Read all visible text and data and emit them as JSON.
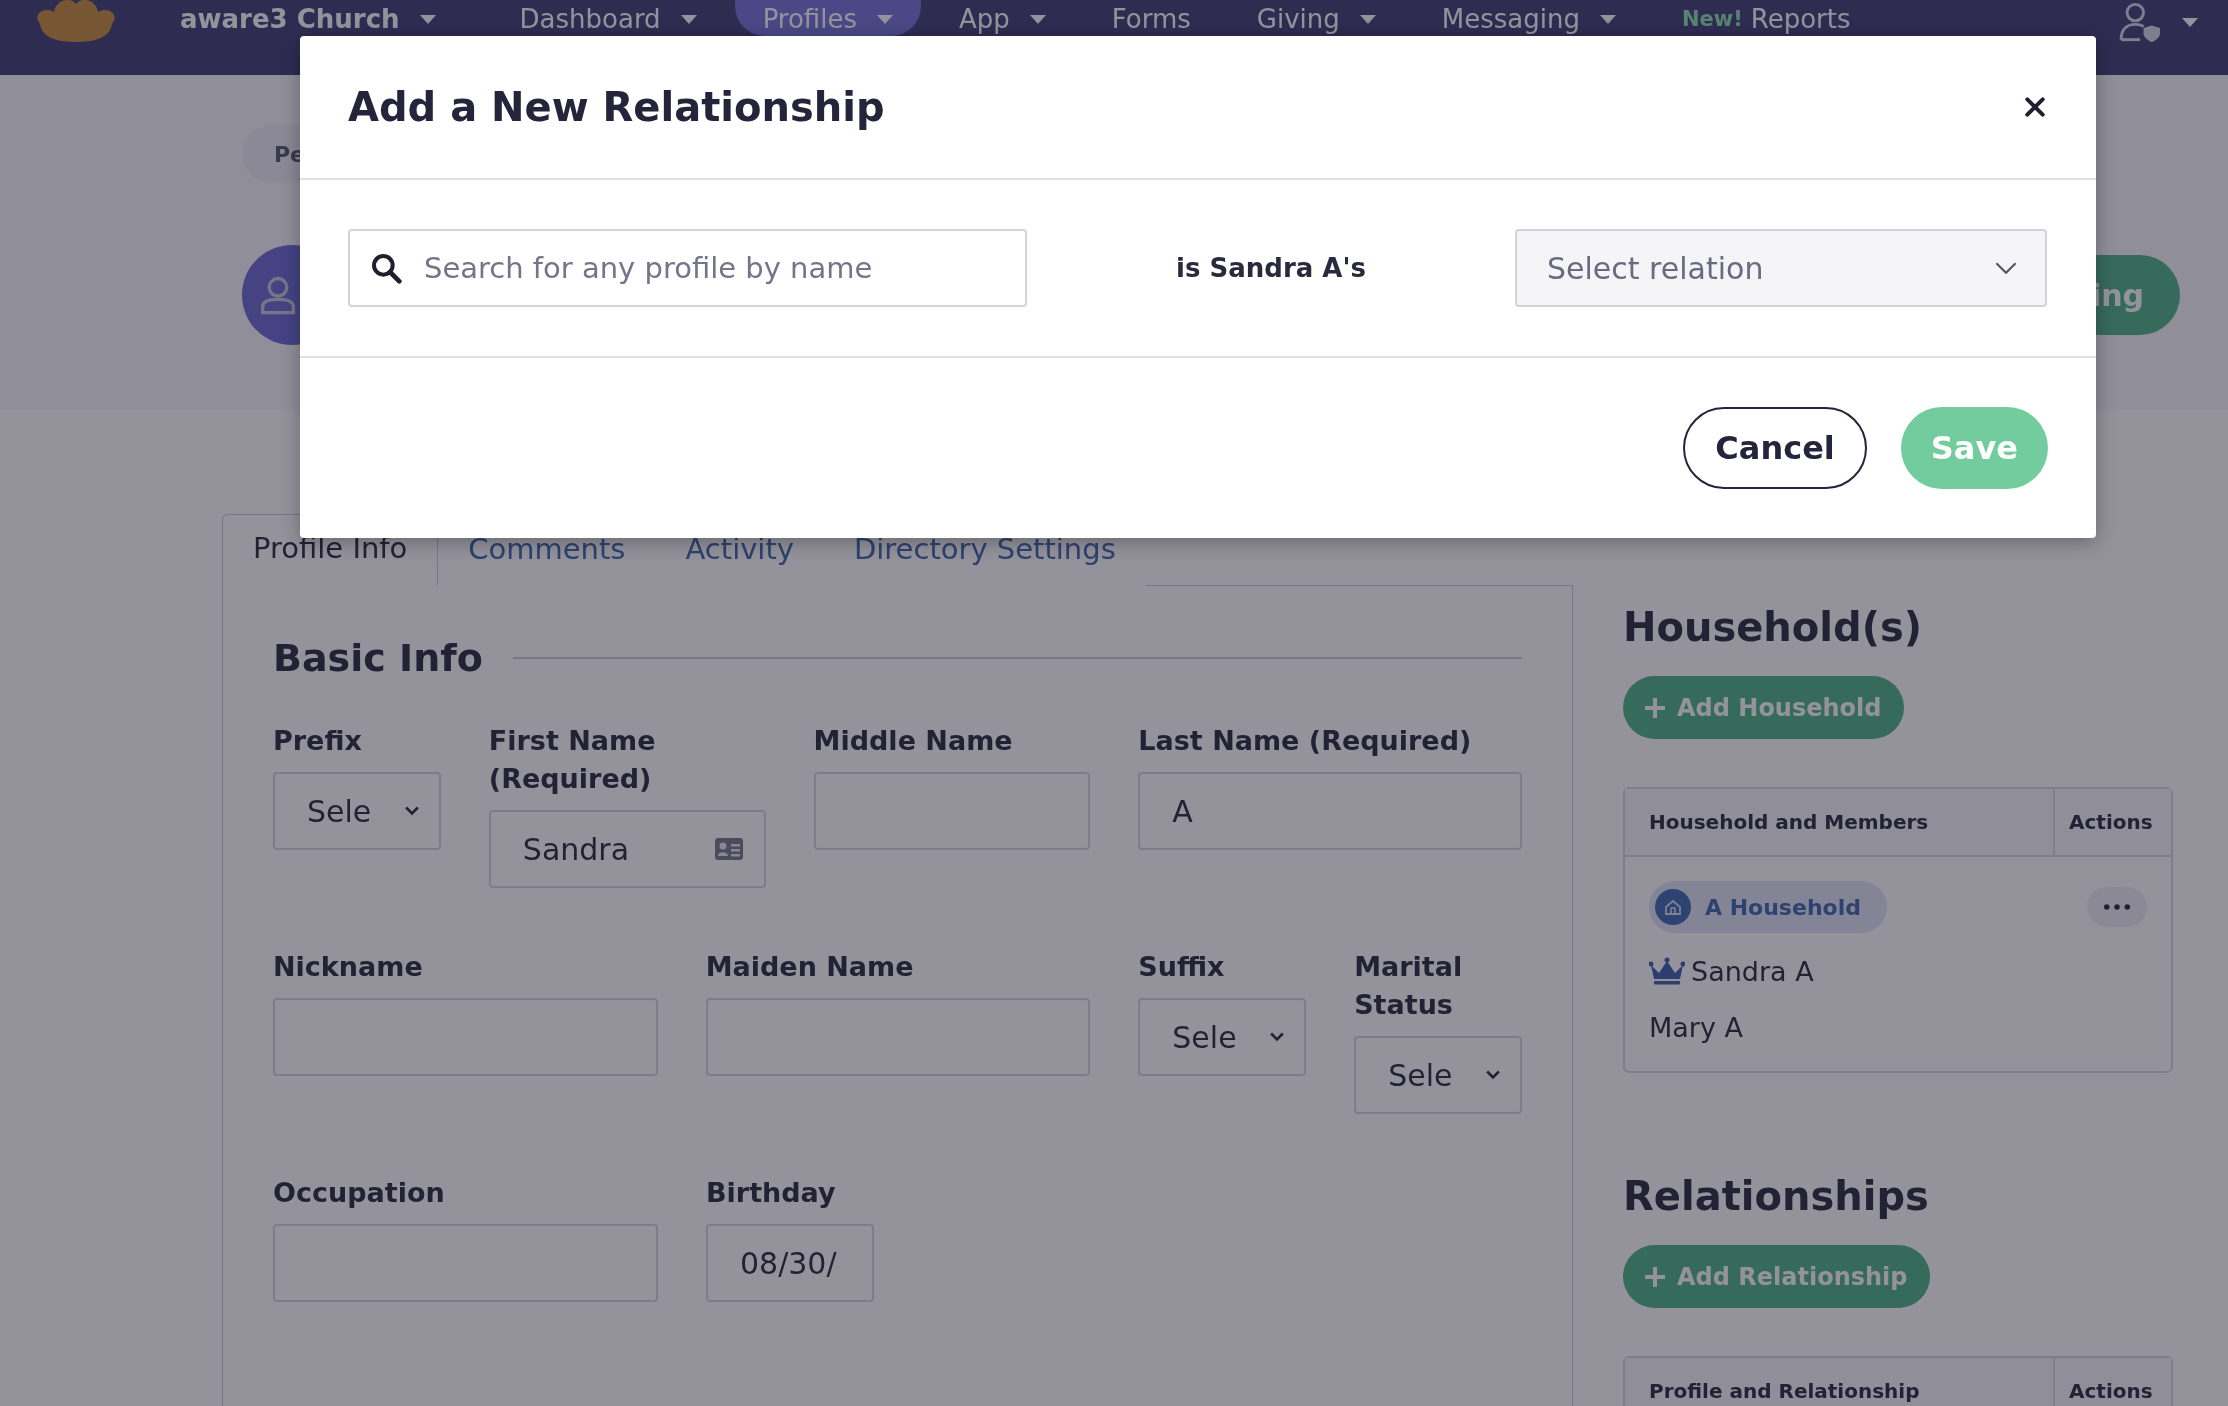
{
  "nav": {
    "org": "aware3 Church",
    "items": [
      {
        "label": "Dashboard",
        "dropdown": true,
        "selected": false
      },
      {
        "label": "Profiles",
        "dropdown": true,
        "selected": true
      },
      {
        "label": "App",
        "dropdown": true,
        "selected": false
      },
      {
        "label": "Forms",
        "dropdown": false,
        "selected": false
      },
      {
        "label": "Giving",
        "dropdown": true,
        "selected": false
      },
      {
        "label": "Messaging",
        "dropdown": true,
        "selected": false
      },
      {
        "label": "Reports",
        "badge": "New!",
        "dropdown": false,
        "selected": false
      }
    ]
  },
  "breadcrumb": "Pe",
  "header_button": "ing",
  "tabs": [
    {
      "label": "Profile Info",
      "selected": true
    },
    {
      "label": "Comments",
      "selected": false
    },
    {
      "label": "Activity",
      "selected": false
    },
    {
      "label": "Directory Settings",
      "selected": false
    }
  ],
  "basic_info": {
    "title": "Basic Info",
    "fields": [
      {
        "label": "Prefix",
        "kind": "select",
        "value": "Sele"
      },
      {
        "label": "First Name (Required)",
        "kind": "card",
        "value": "Sandra"
      },
      {
        "label": "Middle Name",
        "kind": "text"
      },
      {
        "label": "Last Name (Required)",
        "kind": "text",
        "value": "A"
      },
      {
        "label": "Nickname",
        "kind": "text"
      },
      {
        "label": "Maiden Name",
        "kind": "text"
      },
      {
        "label": "Suffix",
        "kind": "select",
        "value": "Sele"
      },
      {
        "label": "Marital Status",
        "kind": "select",
        "value": "Sele"
      },
      {
        "label": "Occupation",
        "kind": "text"
      },
      {
        "label": "Birthday",
        "kind": "text",
        "value": "08/30/"
      }
    ]
  },
  "households": {
    "title": "Household(s)",
    "add_button": "Add Household",
    "columns": [
      "Household and Members",
      "Actions"
    ],
    "household": "A Household",
    "members": [
      {
        "name": "Sandra A",
        "head": true
      },
      {
        "name": "Mary A",
        "head": false
      }
    ]
  },
  "relationships": {
    "title": "Relationships",
    "add_button": "Add Relationship",
    "columns": [
      "Profile and Relationship",
      "Actions"
    ]
  },
  "modal": {
    "title": "Add a New Relationship",
    "search": {
      "placeholder": "Search for any profile by name"
    },
    "connector": "is Sandra A's",
    "relation": {
      "placeholder": "Select relation"
    },
    "buttons": [
      {
        "label": "Cancel",
        "kind": "secondary"
      },
      {
        "label": "Save",
        "kind": "primary"
      }
    ]
  }
}
